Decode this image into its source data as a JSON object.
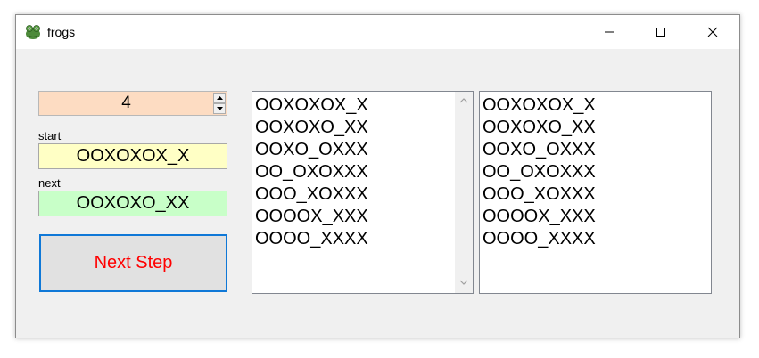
{
  "window": {
    "title": "frogs",
    "controls": [
      "minimize-icon",
      "maximize-icon",
      "close-icon"
    ]
  },
  "spinner": {
    "value": "4"
  },
  "start": {
    "label": "start",
    "value": "OOXOXOX_X"
  },
  "next": {
    "label": "next",
    "value": "OOXOXO_XX"
  },
  "next_step_button": {
    "label": "Next Step"
  },
  "left_list": {
    "items": [
      "OOXOXOX_X",
      "OOXOXO_XX",
      "OOXO_OXXX",
      "OO_OXOXXX",
      "OOO_XOXXX",
      "OOOOX_XXX",
      "OOOO_XXXX"
    ]
  },
  "right_list": {
    "items": [
      "OOXOXOX_X",
      "OOXOXO_XX",
      "OOXO_OXXX",
      "OO_OXOXXX",
      "OOO_XOXXX",
      "OOOOX_XXX",
      "OOOO_XXXX"
    ]
  },
  "colors": {
    "spinner_bg": "#fddcc2",
    "start_bg": "#ffffc5",
    "next_bg": "#c8ffc8",
    "button_text": "#ff0000",
    "button_border": "#0f78d7"
  }
}
